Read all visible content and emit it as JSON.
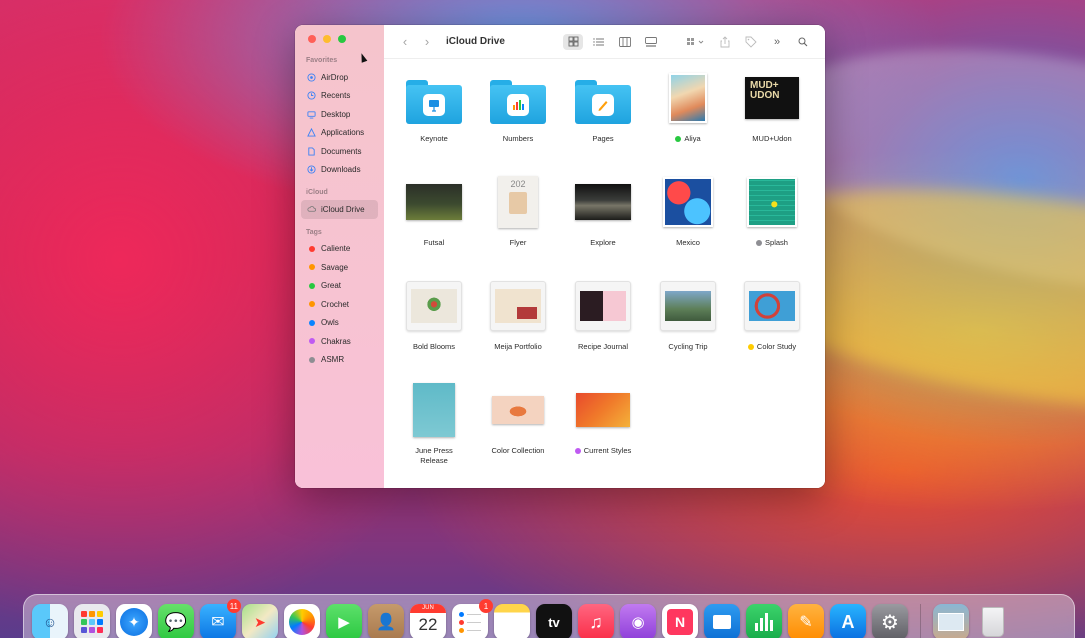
{
  "window": {
    "title": "iCloud Drive"
  },
  "sidebar": {
    "favorites_header": "Favorites",
    "favorites": [
      {
        "label": "AirDrop",
        "icon": "airdrop-icon"
      },
      {
        "label": "Recents",
        "icon": "clock-icon"
      },
      {
        "label": "Desktop",
        "icon": "desktop-icon"
      },
      {
        "label": "Applications",
        "icon": "applications-icon"
      },
      {
        "label": "Documents",
        "icon": "document-icon"
      },
      {
        "label": "Downloads",
        "icon": "download-icon"
      }
    ],
    "icloud_header": "iCloud",
    "icloud": [
      {
        "label": "iCloud Drive",
        "icon": "cloud-icon",
        "selected": true
      }
    ],
    "tags_header": "Tags",
    "tags": [
      {
        "label": "Caliente",
        "color": "#ff3b30"
      },
      {
        "label": "Savage",
        "color": "#ff9500"
      },
      {
        "label": "Great",
        "color": "#28c840"
      },
      {
        "label": "Crochet",
        "color": "#ff9500"
      },
      {
        "label": "Owls",
        "color": "#0a84ff"
      },
      {
        "label": "Chakras",
        "color": "#bf5af2"
      },
      {
        "label": "ASMR",
        "color": "#8e8e93"
      }
    ]
  },
  "files": [
    {
      "label": "Keynote",
      "kind": "folder",
      "icon": "keynote-icon"
    },
    {
      "label": "Numbers",
      "kind": "folder",
      "icon": "numbers-icon"
    },
    {
      "label": "Pages",
      "kind": "folder",
      "icon": "pages-icon"
    },
    {
      "label": "Aliya",
      "kind": "photo",
      "tag_color": "#28c840"
    },
    {
      "label": "MUD+Udon",
      "kind": "poster",
      "poster_text": "MUD+ UDON"
    },
    {
      "label": "Futsal",
      "kind": "video"
    },
    {
      "label": "Flyer",
      "kind": "document",
      "doc_text": "202"
    },
    {
      "label": "Explore",
      "kind": "video"
    },
    {
      "label": "Mexico",
      "kind": "photo"
    },
    {
      "label": "Splash",
      "kind": "photo",
      "tag_color": "#8e8e93"
    },
    {
      "label": "Bold Blooms",
      "kind": "keynote-doc"
    },
    {
      "label": "Meija Portfolio",
      "kind": "keynote-doc"
    },
    {
      "label": "Recipe Journal",
      "kind": "keynote-doc"
    },
    {
      "label": "Cycling Trip",
      "kind": "keynote-doc"
    },
    {
      "label": "Color Study",
      "kind": "keynote-doc",
      "tag_color": "#ffcc00"
    },
    {
      "label": "June Press Release",
      "kind": "pages-doc"
    },
    {
      "label": "Color Collection",
      "kind": "image"
    },
    {
      "label": "Current Styles",
      "kind": "image",
      "tag_color": "#bf5af2"
    }
  ],
  "dock": {
    "apps": [
      {
        "name": "Finder",
        "icon": "finder-icon"
      },
      {
        "name": "Launchpad",
        "icon": "launchpad-icon"
      },
      {
        "name": "Safari",
        "icon": "safari-icon"
      },
      {
        "name": "Messages",
        "icon": "messages-icon"
      },
      {
        "name": "Mail",
        "icon": "mail-icon",
        "badge": "11"
      },
      {
        "name": "Maps",
        "icon": "maps-icon"
      },
      {
        "name": "Photos",
        "icon": "photos-icon"
      },
      {
        "name": "FaceTime",
        "icon": "facetime-icon"
      },
      {
        "name": "Contacts",
        "icon": "contacts-icon"
      },
      {
        "name": "Calendar",
        "icon": "calendar-icon",
        "month": "JUN",
        "day": "22"
      },
      {
        "name": "Reminders",
        "icon": "reminders-icon",
        "badge": "1"
      },
      {
        "name": "Notes",
        "icon": "notes-icon"
      },
      {
        "name": "TV",
        "icon": "tv-icon",
        "text": "tv"
      },
      {
        "name": "Music",
        "icon": "music-icon"
      },
      {
        "name": "Podcasts",
        "icon": "podcasts-icon"
      },
      {
        "name": "News",
        "icon": "news-icon"
      },
      {
        "name": "Keynote",
        "icon": "keynote-icon"
      },
      {
        "name": "Numbers",
        "icon": "numbers-icon"
      },
      {
        "name": "Pages",
        "icon": "pages-icon"
      },
      {
        "name": "App Store",
        "icon": "app-store-icon"
      },
      {
        "name": "System Preferences",
        "icon": "gear-icon"
      },
      {
        "name": "Downloads Stack",
        "icon": "downloads-stack-icon"
      },
      {
        "name": "Trash",
        "icon": "trash-icon"
      }
    ]
  }
}
